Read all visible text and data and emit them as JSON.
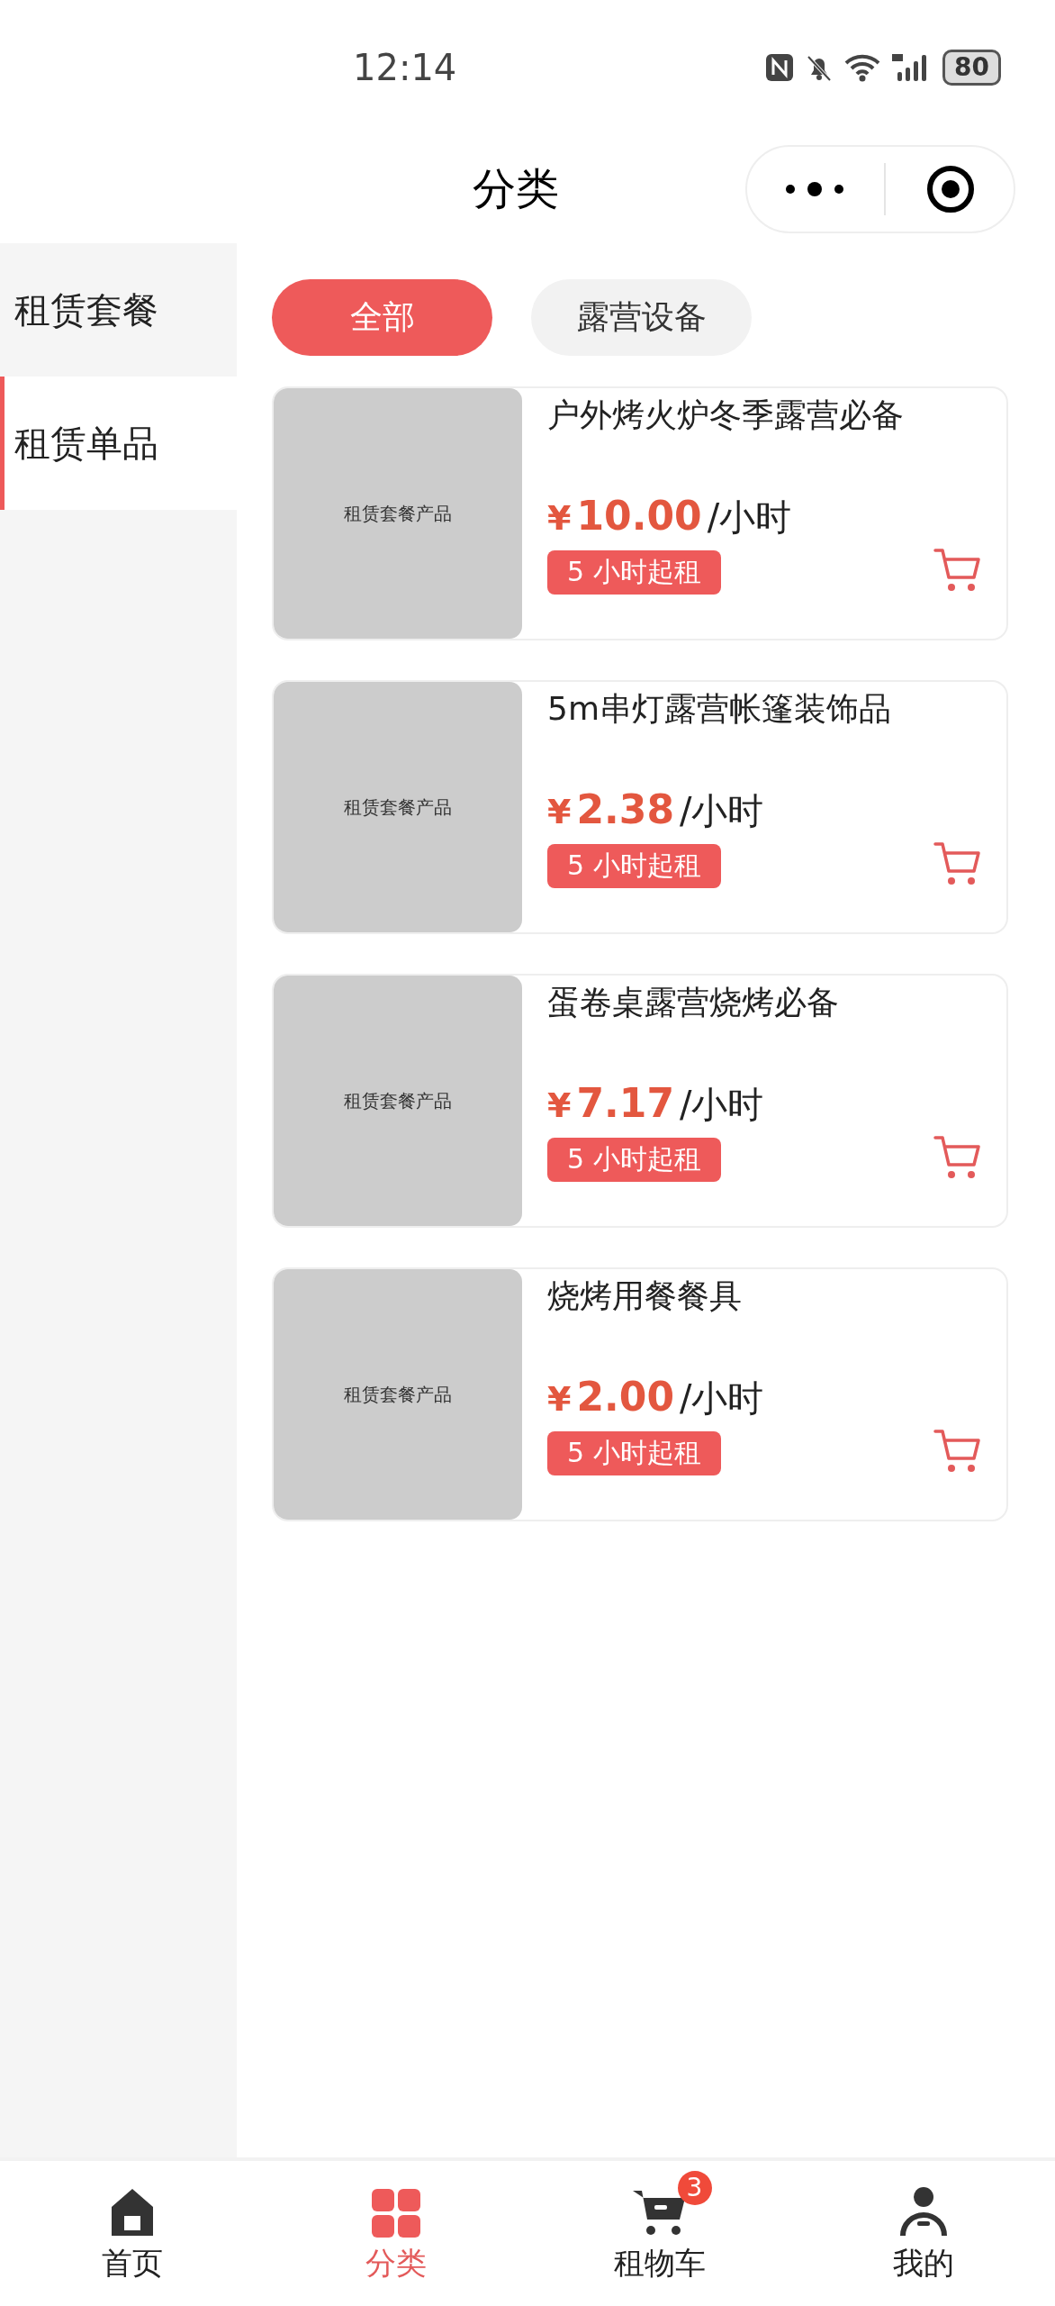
{
  "status_bar": {
    "time": "12:14",
    "battery": "80"
  },
  "nav_bar": {
    "title": "分类"
  },
  "sidebar": {
    "items": [
      {
        "label": "租赁套餐",
        "selected": false
      },
      {
        "label": "租赁单品",
        "selected": true
      }
    ]
  },
  "filters": [
    {
      "label": "全部",
      "selected": true
    },
    {
      "label": "露营设备",
      "selected": false
    }
  ],
  "products": [
    {
      "image_label": "租赁套餐产品",
      "name": "户外烤火炉冬季露营必备",
      "currency": "¥",
      "price": "10.00",
      "unit": "/小时",
      "min_rent": "5 小时起租"
    },
    {
      "image_label": "租赁套餐产品",
      "name": "5m串灯露营帐篷装饰品",
      "currency": "¥",
      "price": "2.38",
      "unit": "/小时",
      "min_rent": "5 小时起租"
    },
    {
      "image_label": "租赁套餐产品",
      "name": "蛋卷桌露营烧烤必备",
      "currency": "¥",
      "price": "7.17",
      "unit": "/小时",
      "min_rent": "5 小时起租"
    },
    {
      "image_label": "租赁套餐产品",
      "name": "烧烤用餐餐具",
      "currency": "¥",
      "price": "2.00",
      "unit": "/小时",
      "min_rent": "5 小时起租"
    }
  ],
  "tab_bar": [
    {
      "kind": "home",
      "label": "首页",
      "selected": false
    },
    {
      "kind": "category",
      "label": "分类",
      "selected": true
    },
    {
      "kind": "cart",
      "label": "租物车",
      "selected": false,
      "badge": "3"
    },
    {
      "kind": "profile",
      "label": "我的",
      "selected": false
    }
  ]
}
